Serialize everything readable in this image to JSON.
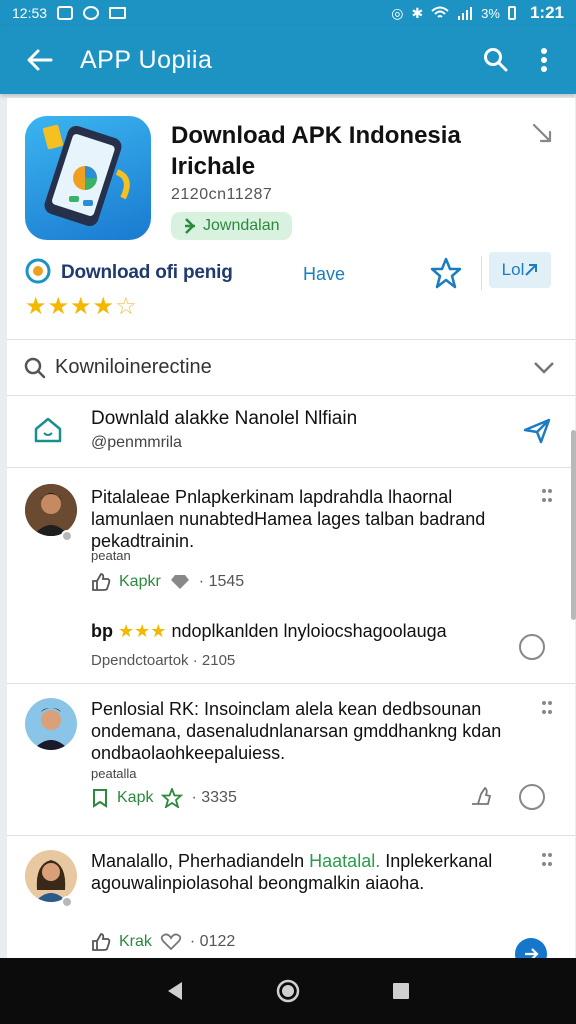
{
  "status_bar": {
    "time_left": "12:53",
    "battery": "3%",
    "time_right": "1:21"
  },
  "app_bar": {
    "title": "APP Uopiia"
  },
  "app": {
    "title_line1": "Download APK Indonesia",
    "title_line2": "Irichale",
    "id": "2120cn11287",
    "chip_label": "Jowndalan"
  },
  "rating_row": {
    "download_label": "Download ofi penig",
    "stars_filled": "★★★★",
    "stars_empty": "☆",
    "have_label": "Have",
    "button_label": "Lol"
  },
  "search": {
    "label": "Kowniloinerectine"
  },
  "feed_header": {
    "title": "Downlald alakke Nanolel Nlfiain",
    "subtitle": "@penmmrila"
  },
  "posts": [
    {
      "text": "Pitalaleae Pnlapkerkinam lapdrahdla lhaornal lamunlaen nunabtedHamea lages talban badrand pekadtrainin.",
      "meta": "peatan",
      "action_label": "Kapkr",
      "count": "· 1545"
    },
    {
      "text_prefix": "bp",
      "stars": "★★★",
      "text_rest": "ndoplkanlden lnyloiocshagoolauga",
      "meta": "Dpendctoartok · 2105"
    },
    {
      "text": "Penlosial RK: Insoinclam alela kean dedbsounan ondemana, dasenaludnlanarsan gmddhankng kdan ondbaolaohkeepaluiess.",
      "meta": "peatalla",
      "action_label": "Kapk",
      "count": "· 3335"
    },
    {
      "text_plain": "Manalallo, Pherhadiandeln ",
      "text_highlight": "Haatalal.",
      "text_tail": " Inplekerkanal agouwalinpiolasohal beongmalkin aiaoha.",
      "action_label": "Krak",
      "count": "· 0122"
    }
  ],
  "colors": {
    "primary": "#1d93c4",
    "accent_green": "#2b8a3e",
    "star": "#f5b800",
    "fab": "#1477cc"
  }
}
